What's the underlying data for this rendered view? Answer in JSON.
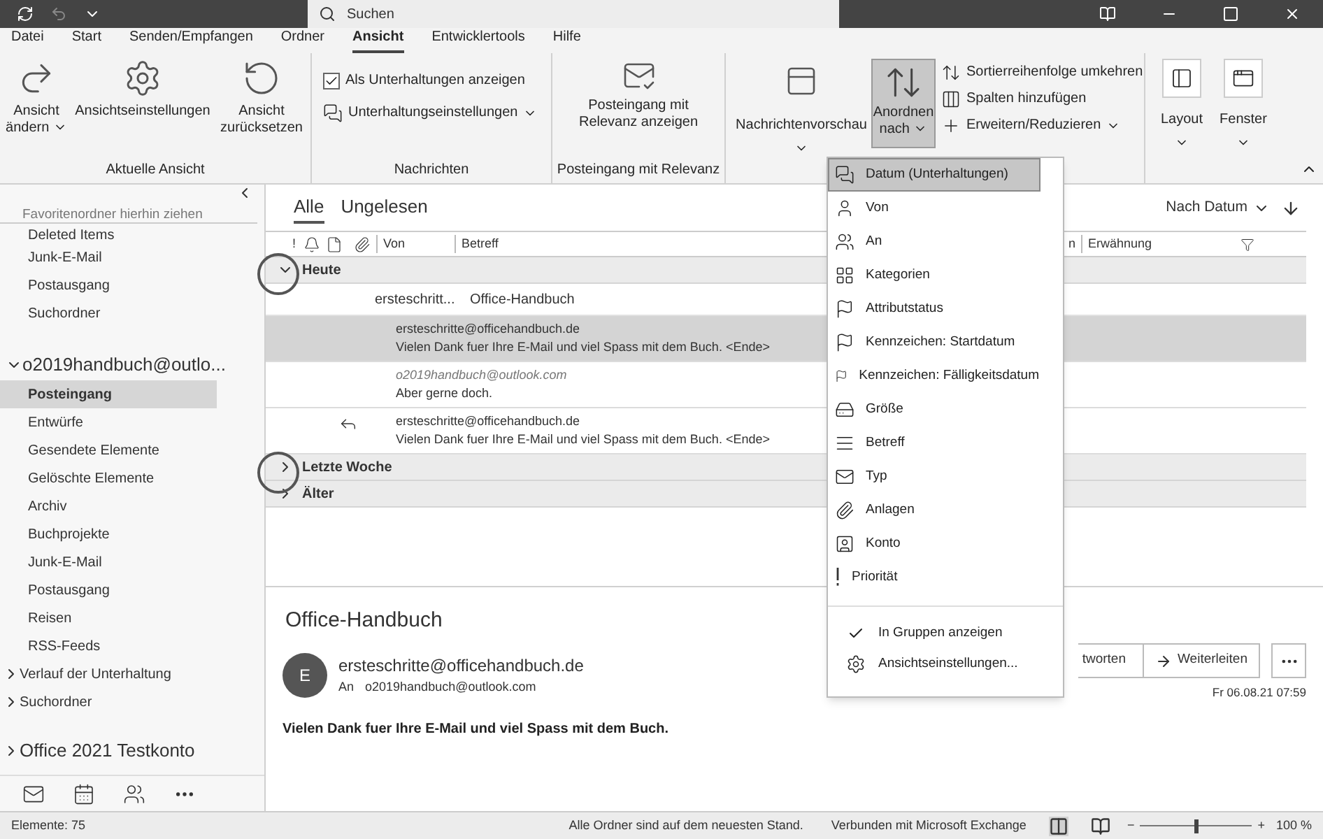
{
  "title_bar": {
    "search_placeholder": "Suchen"
  },
  "ribbon_tabs": [
    {
      "label": "Datei",
      "selected": false
    },
    {
      "label": "Start",
      "selected": false
    },
    {
      "label": "Senden/Empfangen",
      "selected": false
    },
    {
      "label": "Ordner",
      "selected": false
    },
    {
      "label": "Ansicht",
      "selected": true
    },
    {
      "label": "Entwicklertools",
      "selected": false
    },
    {
      "label": "Hilfe",
      "selected": false
    }
  ],
  "ribbon": {
    "current_view": {
      "label": "Aktuelle Ansicht",
      "buttons": [
        {
          "label": "Ansicht ändern",
          "dropdown": true
        },
        {
          "label": "Ansichtseinstellungen"
        },
        {
          "label": "Ansicht zurücksetzen"
        }
      ]
    },
    "messages": {
      "label": "Nachrichten",
      "conversation_checkbox": {
        "label": "Als Unterhaltungen anzeigen",
        "checked": true
      },
      "conversation_settings": "Unterhaltungseinstellungen"
    },
    "focused": {
      "label": "Posteingang mit Relevanz",
      "button": "Posteingang mit Relevanz anzeigen"
    },
    "arrangement": {
      "preview": "Nachrichtenvorschau",
      "arrange": {
        "label": "Anordnen nach",
        "pressed": true
      },
      "actions": [
        {
          "label": "Sortierreihenfolge umkehren"
        },
        {
          "label": "Spalten hinzufügen"
        },
        {
          "label": "Erweitern/Reduzieren",
          "dropdown": true
        }
      ]
    },
    "window": [
      {
        "label": "Layout"
      },
      {
        "label": "Fenster"
      }
    ]
  },
  "sidebar": {
    "favorites_hint": "Favoritenordner hierhin ziehen",
    "favorites": [
      {
        "label": "Deleted Items",
        "selected": false
      },
      {
        "label": "Junk-E-Mail",
        "selected": false
      },
      {
        "label": "Postausgang",
        "selected": false
      },
      {
        "label": "Suchordner",
        "selected": false
      }
    ],
    "account": {
      "label": "o2019handbuch@outlo...",
      "expanded": true,
      "folders": [
        {
          "label": "Posteingang",
          "selected": true
        },
        {
          "label": "Entwürfe",
          "selected": false
        },
        {
          "label": "Gesendete Elemente",
          "selected": false
        },
        {
          "label": "Gelöschte Elemente",
          "selected": false
        },
        {
          "label": "Archiv",
          "selected": false
        },
        {
          "label": "Buchprojekte",
          "selected": false
        },
        {
          "label": "Junk-E-Mail",
          "selected": false
        },
        {
          "label": "Postausgang",
          "selected": false
        },
        {
          "label": "Reisen",
          "selected": false
        },
        {
          "label": "RSS-Feeds",
          "selected": false
        }
      ],
      "subgroups": [
        {
          "label": "Verlauf der Unterhaltung",
          "expanded": false
        },
        {
          "label": "Suchordner",
          "expanded": false
        }
      ]
    },
    "other_account": {
      "label": "Office 2021 Testkonto",
      "expanded": false
    }
  },
  "mail_list": {
    "filters": [
      {
        "label": "Alle",
        "selected": true
      },
      {
        "label": "Ungelesen",
        "selected": false
      }
    ],
    "sort": "Nach Datum",
    "columns": {
      "importance": "!",
      "from": "Von",
      "subject": "Betreff",
      "column_4": "n",
      "mention": "Erwähnung"
    },
    "groups": [
      {
        "label": "Heute",
        "expanded": true,
        "conversation": {
          "sender": "ersteschritt...",
          "subject": "Office-Handbuch",
          "messages": [
            {
              "sender": "ersteschritte@officehandbuch.de",
              "preview": "Vielen Dank fuer Ihre E-Mail und viel Spass mit dem Buch. <Ende>",
              "selected": true,
              "sent": false,
              "replied": false
            },
            {
              "sender": "o2019handbuch@outlook.com",
              "preview": "Aber gerne doch.",
              "selected": false,
              "sent": true,
              "replied": false
            },
            {
              "sender": "ersteschritte@officehandbuch.de",
              "preview": "Vielen Dank fuer Ihre E-Mail und viel Spass mit dem Buch. <Ende>",
              "selected": false,
              "sent": false,
              "replied": true
            }
          ]
        }
      },
      {
        "label": "Letzte Woche",
        "expanded": false
      },
      {
        "label": "Älter",
        "expanded": false
      }
    ]
  },
  "reading_pane": {
    "subject": "Office-Handbuch",
    "avatar": "E",
    "sender": "ersteschritte@officehandbuch.de",
    "to_label": "An",
    "to": "o2019handbuch@outlook.com",
    "actions": [
      "tworten",
      "Weiterleiten"
    ],
    "date": "Fr 06.08.21 07:59",
    "body": "Vielen Dank fuer Ihre E-Mail und viel Spass mit dem Buch."
  },
  "arrange_menu": {
    "items": [
      {
        "label": "Datum (Unterhaltungen)",
        "selected": true
      },
      {
        "label": "Von",
        "selected": false
      },
      {
        "label": "An",
        "selected": false
      },
      {
        "label": "Kategorien",
        "selected": false
      },
      {
        "label": "Attributstatus",
        "selected": false
      },
      {
        "label": "Kennzeichen: Startdatum",
        "selected": false
      },
      {
        "label": "Kennzeichen: Fälligkeitsdatum",
        "selected": false
      },
      {
        "label": "Größe",
        "selected": false
      },
      {
        "label": "Betreff",
        "selected": false
      },
      {
        "label": "Typ",
        "selected": false
      },
      {
        "label": "Anlagen",
        "selected": false
      },
      {
        "label": "Konto",
        "selected": false
      },
      {
        "label": "Priorität",
        "selected": false
      }
    ],
    "options": [
      {
        "kind": "toggle",
        "label": "In Gruppen anzeigen",
        "checked": true
      },
      {
        "kind": "command",
        "label": "Ansichtseinstellungen..."
      }
    ]
  },
  "status_bar": {
    "items": "Elemente: 75",
    "sync": "Alle Ordner sind auf dem neuesten Stand.",
    "connection": "Verbunden mit Microsoft Exchange",
    "zoom_out": "−",
    "zoom_in": "+",
    "zoom": {
      "level": 0.5
    },
    "zoom_label": "100 %"
  }
}
